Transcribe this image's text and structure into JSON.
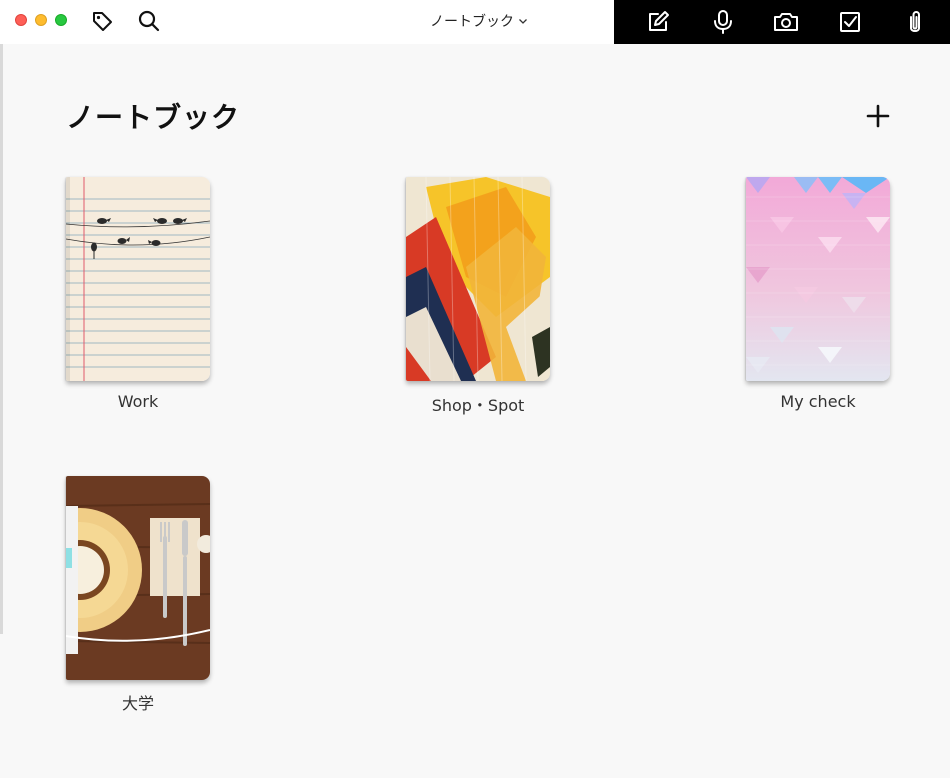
{
  "window": {
    "title": "ノートブック",
    "title_menu_icon": "chevron-down-icon",
    "traffic_lights": [
      "#fe5f57",
      "#febc2e",
      "#28c840"
    ]
  },
  "toolbar": {
    "left_icons": [
      "tag-icon",
      "search-icon"
    ],
    "right_icons": [
      "compose-icon",
      "microphone-icon",
      "camera-icon",
      "checkbox-icon",
      "paperclip-icon"
    ],
    "accent": "#000000"
  },
  "main": {
    "heading": "ノートブック",
    "add_icon": "plus-icon",
    "notebooks": [
      {
        "label": "Work",
        "cover": "lined-paper-birds"
      },
      {
        "label": "Shop・Spot",
        "cover": "abstract-paint"
      },
      {
        "label": "My check",
        "cover": "pink-triangles"
      },
      {
        "label": "大学",
        "cover": "table-setting"
      }
    ]
  }
}
